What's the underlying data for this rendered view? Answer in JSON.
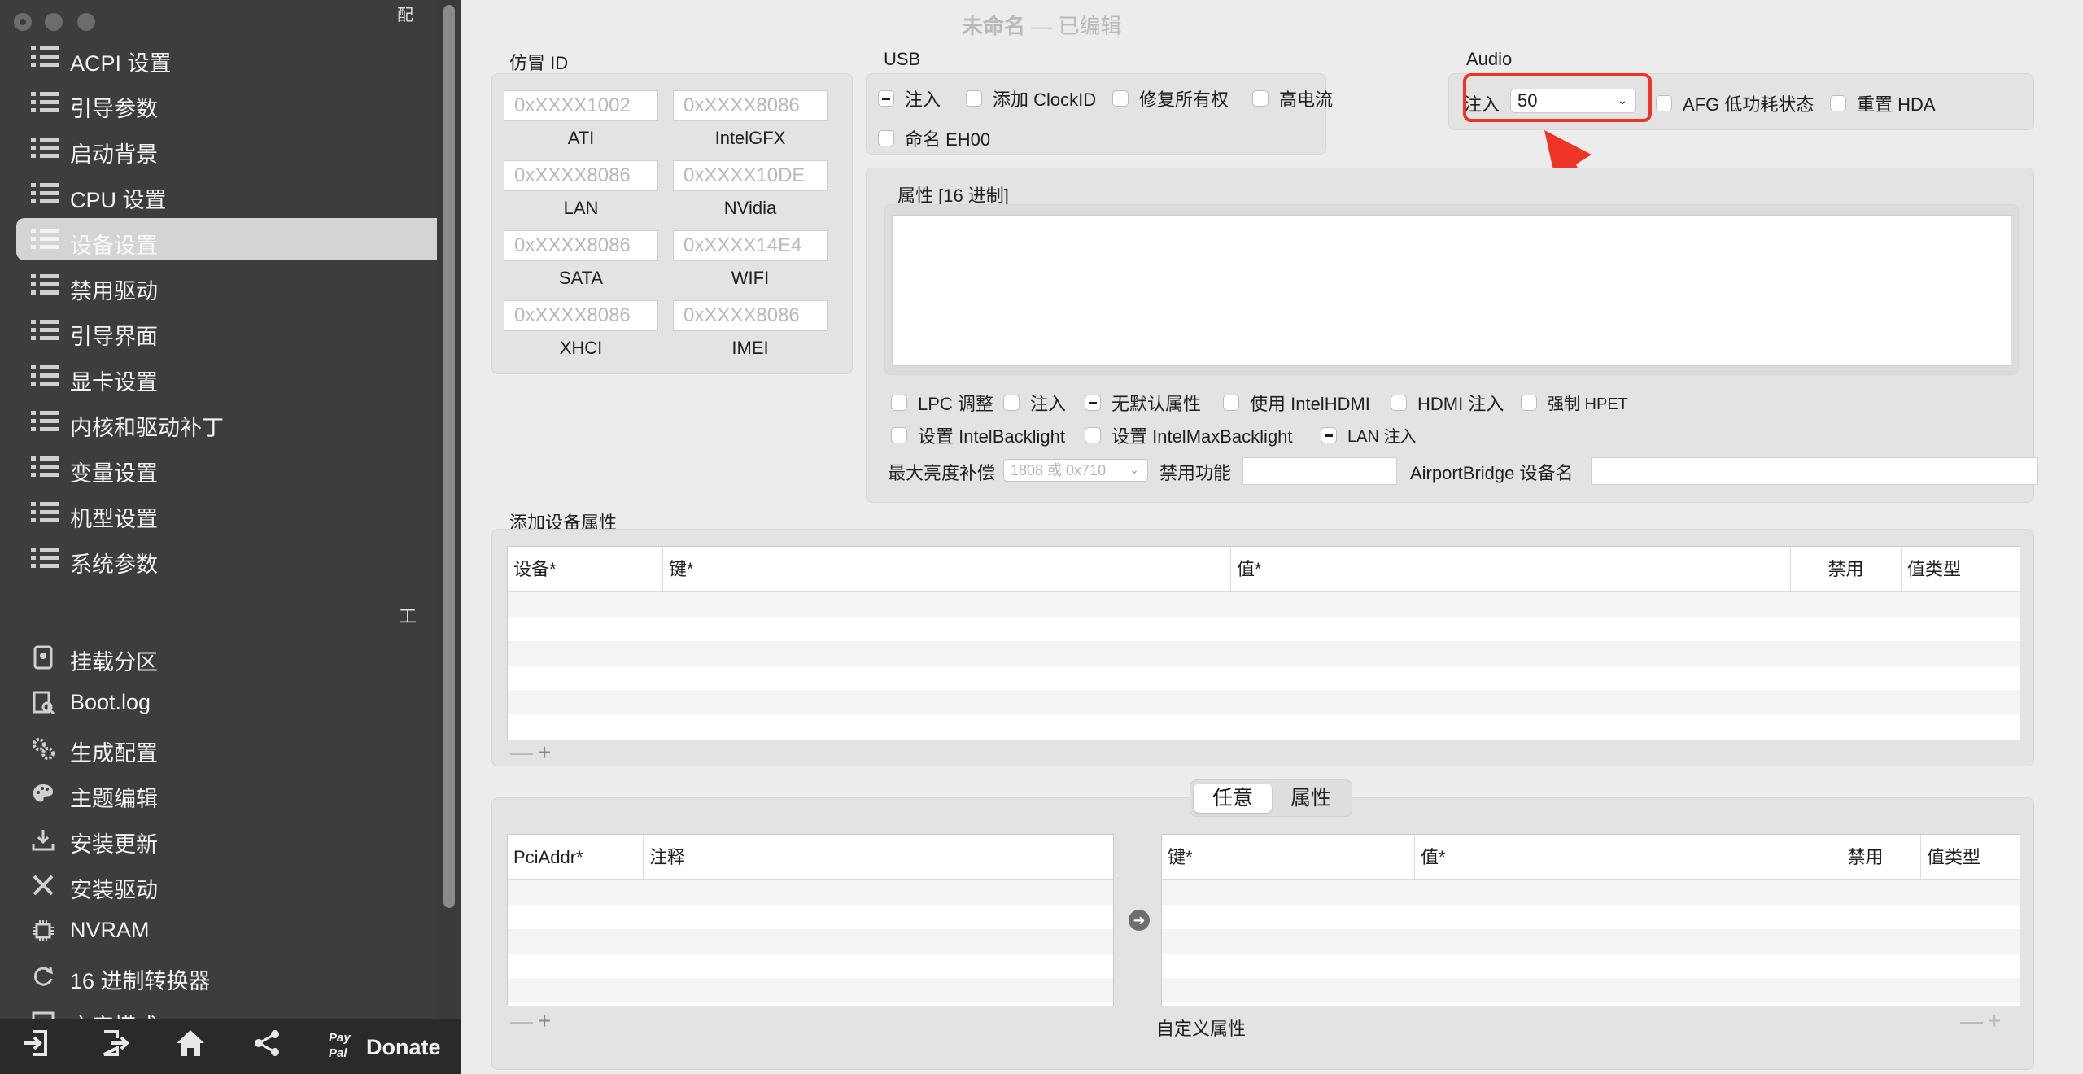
{
  "window": {
    "title": "未命名",
    "separator": "—",
    "status": "已编辑",
    "corner_label": "配"
  },
  "sidebar": {
    "items": [
      {
        "label": "ACPI 设置",
        "icon": "list-icon"
      },
      {
        "label": "引导参数",
        "icon": "list-icon"
      },
      {
        "label": "启动背景",
        "icon": "list-icon"
      },
      {
        "label": "CPU 设置",
        "icon": "list-icon"
      },
      {
        "label": "设备设置",
        "icon": "list-icon",
        "selected": true
      },
      {
        "label": "禁用驱动",
        "icon": "list-icon"
      },
      {
        "label": "引导界面",
        "icon": "list-icon"
      },
      {
        "label": "显卡设置",
        "icon": "list-icon"
      },
      {
        "label": "内核和驱动补丁",
        "icon": "list-icon"
      },
      {
        "label": "变量设置",
        "icon": "list-icon"
      },
      {
        "label": "机型设置",
        "icon": "list-icon"
      },
      {
        "label": "系统参数",
        "icon": "list-icon"
      }
    ],
    "tools_label": "工",
    "tools": [
      {
        "label": "挂载分区",
        "icon": "disk-icon"
      },
      {
        "label": "Boot.log",
        "icon": "log-icon"
      },
      {
        "label": "生成配置",
        "icon": "gears-icon"
      },
      {
        "label": "主题编辑",
        "icon": "palette-icon"
      },
      {
        "label": "安装更新",
        "icon": "download-icon"
      },
      {
        "label": "安装驱动",
        "icon": "tools-icon"
      },
      {
        "label": "NVRAM",
        "icon": "chip-icon"
      },
      {
        "label": "16 进制转换器",
        "icon": "refresh-icon"
      },
      {
        "label": "文字模式",
        "icon": "text-icon"
      }
    ],
    "bottom": {
      "import_icon": "import-icon",
      "export_icon": "export-icon",
      "home_icon": "home-icon",
      "share_icon": "share-icon",
      "paypal_top": "Pay",
      "paypal_bottom": "Pal",
      "donate": "Donate"
    }
  },
  "fake_id": {
    "title": "仿冒 ID",
    "fields": [
      {
        "placeholder": "0xXXXX1002",
        "caption": "ATI"
      },
      {
        "placeholder": "0xXXXX8086",
        "caption": "IntelGFX"
      },
      {
        "placeholder": "0xXXXX8086",
        "caption": "LAN"
      },
      {
        "placeholder": "0xXXXX10DE",
        "caption": "NVidia"
      },
      {
        "placeholder": "0xXXXX8086",
        "caption": "SATA"
      },
      {
        "placeholder": "0xXXXX14E4",
        "caption": "WIFI"
      },
      {
        "placeholder": "0xXXXX8086",
        "caption": "XHCI"
      },
      {
        "placeholder": "0xXXXX8086",
        "caption": "IMEI"
      }
    ]
  },
  "usb": {
    "title": "USB",
    "options": [
      {
        "label": "注入",
        "state": "mixed"
      },
      {
        "label": "添加 ClockID",
        "state": "off"
      },
      {
        "label": "修复所有权",
        "state": "off"
      },
      {
        "label": "高电流",
        "state": "off"
      },
      {
        "label": "命名 EH00",
        "state": "off"
      }
    ]
  },
  "audio": {
    "title": "Audio",
    "inject_label": "注入",
    "inject_value": "50",
    "options": [
      {
        "label": "AFG 低功耗状态",
        "state": "off"
      },
      {
        "label": "重置 HDA",
        "state": "off"
      }
    ]
  },
  "properties": {
    "title": "属性 [16 进制]",
    "row1": [
      {
        "label": "LPC 调整",
        "state": "off"
      },
      {
        "label": "注入",
        "state": "off"
      },
      {
        "label": "无默认属性",
        "state": "mixed"
      },
      {
        "label": "使用 IntelHDMI",
        "state": "off"
      },
      {
        "label": "HDMI 注入",
        "state": "off"
      },
      {
        "label": "强制 HPET",
        "state": "off"
      }
    ],
    "row2": [
      {
        "label": "设置 IntelBacklight",
        "state": "off"
      },
      {
        "label": "设置 IntelMaxBacklight",
        "state": "off"
      },
      {
        "label": "LAN 注入",
        "state": "mixed"
      }
    ],
    "max_brightness_label": "最大亮度补偿",
    "max_brightness_placeholder": "1808 或 0x710",
    "disable_func_label": "禁用功能",
    "airport_label": "AirportBridge 设备名"
  },
  "add_properties": {
    "title": "添加设备属性",
    "columns": [
      "设备*",
      "键*",
      "值*",
      "禁用",
      "值类型"
    ],
    "minus": "—",
    "plus": "+"
  },
  "custom": {
    "tabs": [
      "任意",
      "属性"
    ],
    "active_tab": "任意",
    "left_columns": [
      "PciAddr*",
      "注释"
    ],
    "right_columns": [
      "键*",
      "值*",
      "禁用",
      "值类型"
    ],
    "arrow_icon": "arrow-right-icon",
    "caption": "自定义属性",
    "minus": "—",
    "plus": "+"
  },
  "colors": {
    "highlight": "#ee3424",
    "sidebar_bg": "#3d3d3f"
  }
}
